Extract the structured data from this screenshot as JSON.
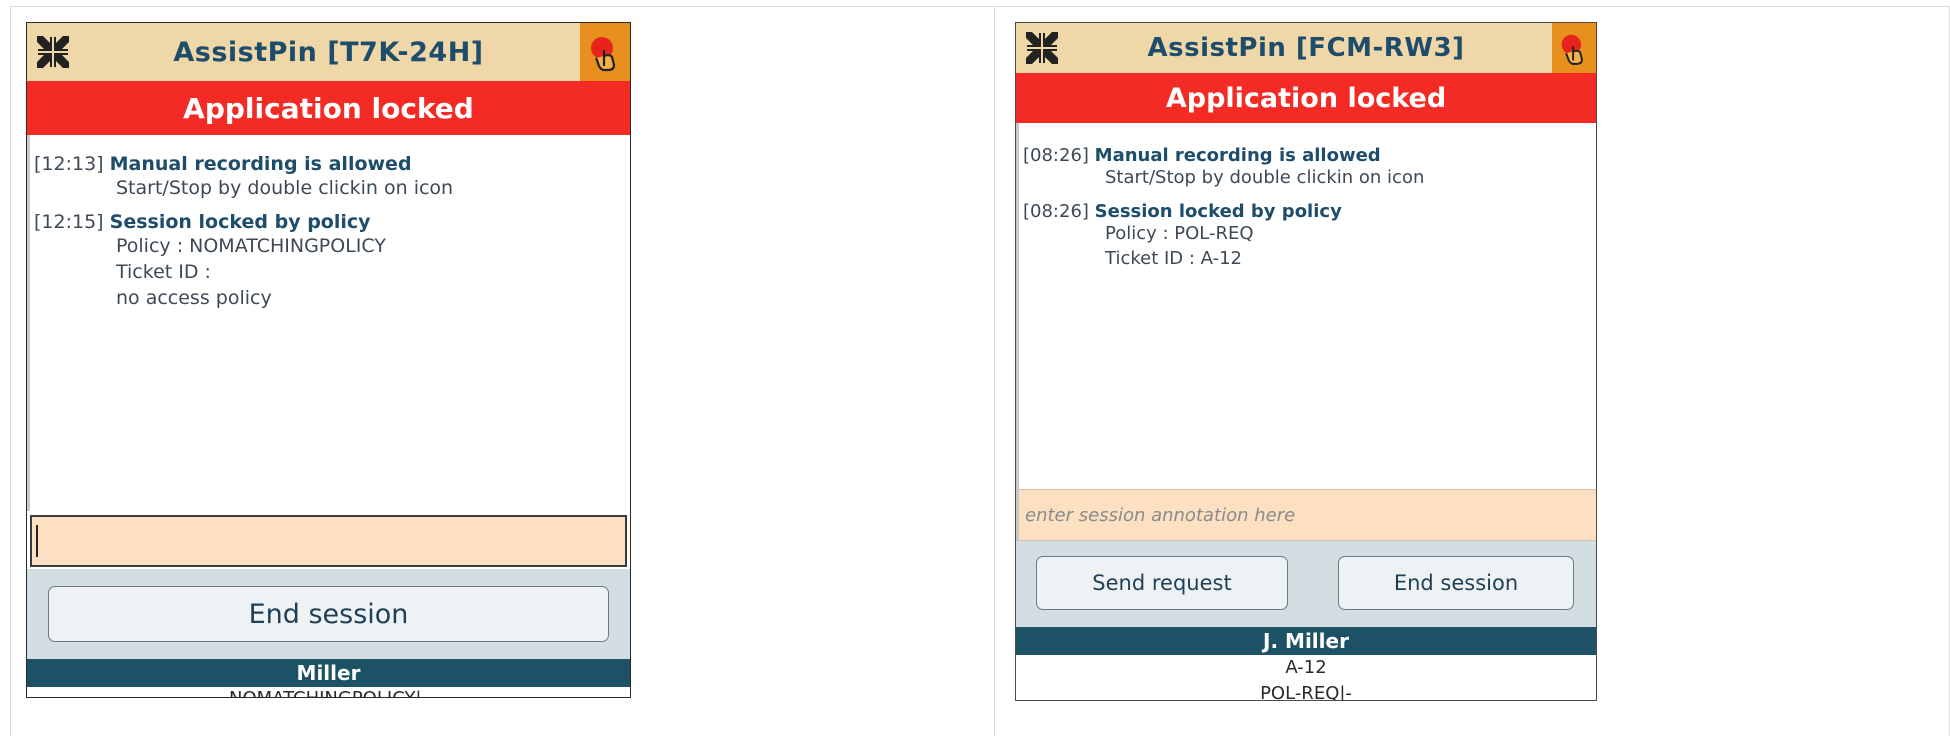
{
  "left": {
    "title": "AssistPin [T7K-24H]",
    "status_banner": "Application locked",
    "log": [
      {
        "time": "[12:13]",
        "title": "Manual recording is allowed",
        "lines": [
          "Start/Stop by double clickin on icon"
        ]
      },
      {
        "time": "[12:15]",
        "title": "Session locked by policy",
        "lines": [
          "Policy : NOMATCHINGPOLICY",
          "Ticket ID :",
          "no access policy"
        ]
      }
    ],
    "annotation_value": "",
    "end_session_label": "End session",
    "user": "Miller",
    "footer_lines": [
      "NOMATCHINGPOLICY|-"
    ]
  },
  "right": {
    "title": "AssistPin [FCM-RW3]",
    "status_banner": "Application locked",
    "log": [
      {
        "time": "[08:26]",
        "title": "Manual recording is allowed",
        "lines": [
          "Start/Stop by double clickin on icon"
        ]
      },
      {
        "time": "[08:26]",
        "title": "Session locked by policy",
        "lines": [
          "Policy : POL-REQ",
          "Ticket ID : A-12"
        ]
      }
    ],
    "annotation_placeholder": "enter session annotation here",
    "send_request_label": "Send request",
    "end_session_label": "End session",
    "user": "J. Miller",
    "footer_lines": [
      "A-12",
      "POL-REQ|-"
    ]
  },
  "colors": {
    "titlebar": "#f0d7a8",
    "title_text": "#1e4d6b",
    "locked_banner": "#f42a25",
    "hand_icon_bg": "#e8901e",
    "annotation_bg": "#fde0c2",
    "button_area": "#d3dde2",
    "user_bar": "#1d5266"
  },
  "icons": {
    "titlebar_left": "shrink-arrows-icon",
    "titlebar_right": "recording-hand-icon"
  }
}
